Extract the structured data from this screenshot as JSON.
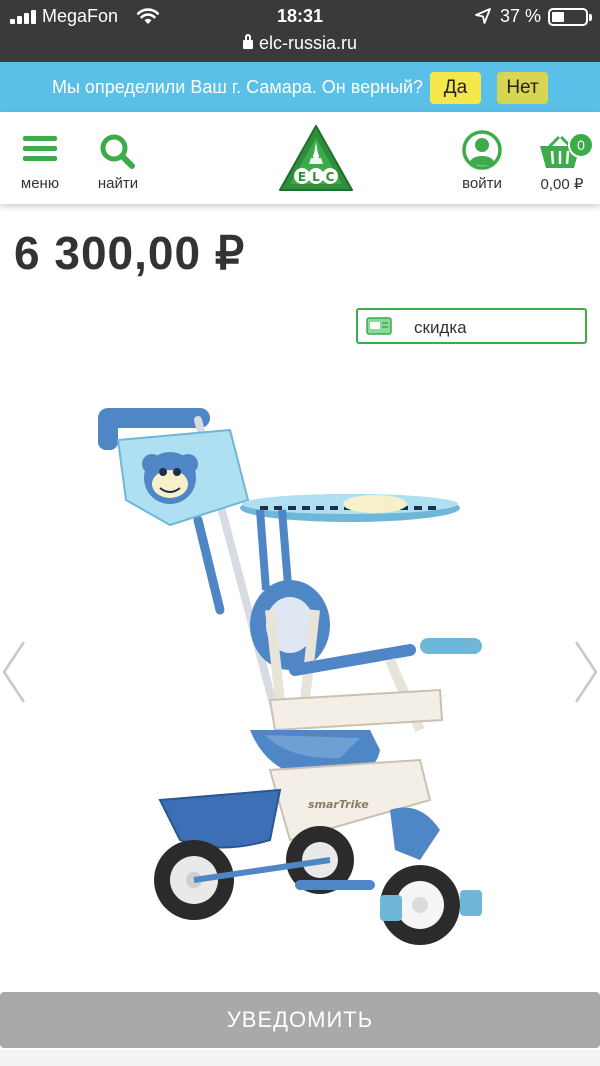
{
  "status_bar": {
    "carrier": "MegaFon",
    "time": "18:31",
    "battery_percent": "37 %",
    "battery_level": 0.37,
    "url": "elc-russia.ru"
  },
  "city_banner": {
    "question": "Мы определили Ваш г. Самара. Он верный?",
    "yes_label": "Да",
    "no_label": "Нет",
    "background": "#5bc0e8"
  },
  "header": {
    "menu_label": "меню",
    "search_label": "найти",
    "login_label": "войти",
    "cart_count": "0",
    "cart_total": "0,00 ₽",
    "logo_text": "ELC",
    "accent_color": "#3cab4a"
  },
  "product": {
    "price": "6 300,00 ₽",
    "discount_label": "скидка",
    "image_alt": "smarTrike",
    "brand_print": "smarTrike"
  },
  "actions": {
    "notify_label": "УВЕДОМИТЬ"
  },
  "icons": {
    "status": [
      "signal-icon",
      "wifi-icon",
      "location-arrow-icon",
      "battery-icon",
      "lock-icon"
    ],
    "header": [
      "hamburger-menu-icon",
      "search-icon",
      "elc-logo",
      "user-icon",
      "basket-icon"
    ],
    "carousel": [
      "chevron-left-icon",
      "chevron-right-icon"
    ]
  }
}
